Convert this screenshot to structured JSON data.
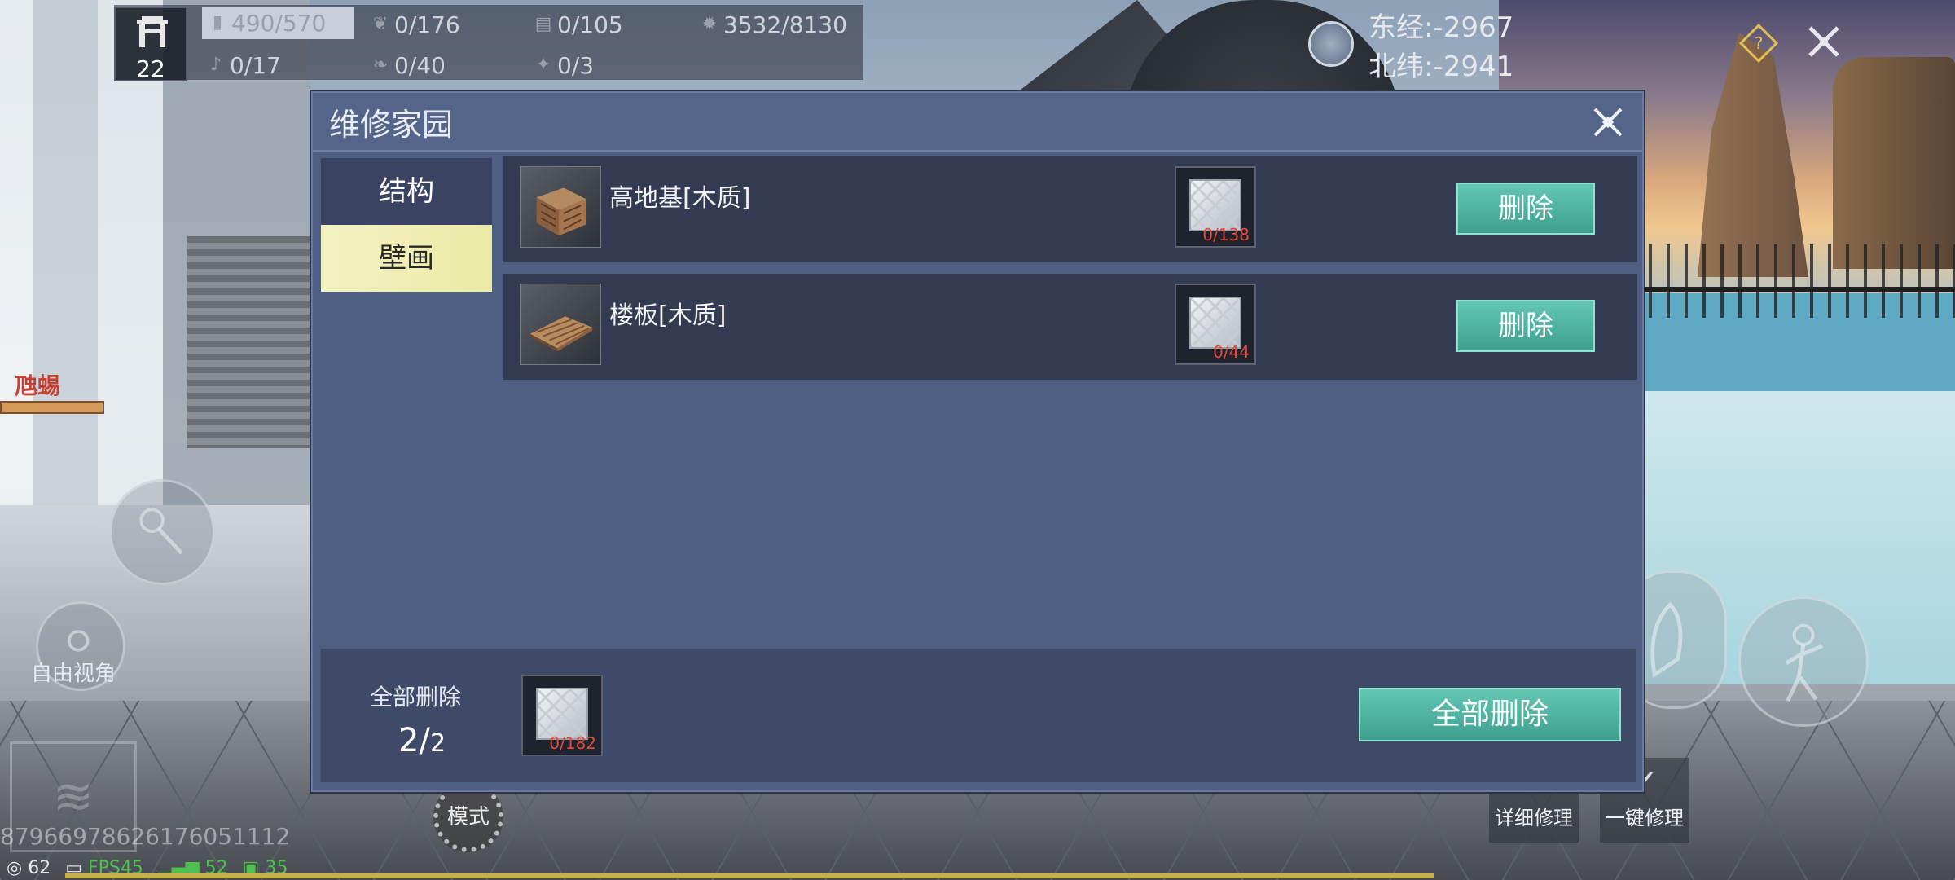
{
  "hud": {
    "level": "22",
    "stats_row1": [
      {
        "icon": "resource-bars-icon",
        "value": "490/570",
        "active": true
      },
      {
        "icon": "leaf-icon",
        "value": "0/176",
        "active": false
      },
      {
        "icon": "cabinet-icon",
        "value": "0/105",
        "active": false
      },
      {
        "icon": "gear-icon",
        "value": "3532/8130",
        "active": false
      }
    ],
    "stats_row2": [
      {
        "icon": "guitar-icon",
        "value": "0/17"
      },
      {
        "icon": "feather-icon",
        "value": "0/40"
      },
      {
        "icon": "bird-icon",
        "value": "0/3"
      }
    ],
    "longitude": "东经:-2967",
    "latitude": "北纬:-2941",
    "help_glyph": "?"
  },
  "left_hud": {
    "npc_name": "虺蜴",
    "free_camera_label": "自由视角",
    "mode_label": "模式",
    "uid": "87966978626176051112",
    "ping": "62",
    "fps": "FPS45",
    "signal": "52",
    "battery": "35"
  },
  "right_hud": {
    "detail_repair": "详细修理",
    "one_click_repair": "一键修理"
  },
  "dialog": {
    "title": "维修家园",
    "tabs": [
      {
        "label": "结构",
        "active": false
      },
      {
        "label": "壁画",
        "active": true
      }
    ],
    "items": [
      {
        "name": "高地基[木质]",
        "thumb": "wooden-crate-icon",
        "cost": "0/138",
        "delete_label": "删除"
      },
      {
        "name": "楼板[木质]",
        "thumb": "wooden-plank-icon",
        "cost": "0/44",
        "delete_label": "删除"
      }
    ],
    "footer": {
      "label": "全部删除",
      "count_current": "2",
      "count_sep": "/",
      "count_total": "2",
      "cost": "0/182",
      "delete_all_label": "全部删除"
    }
  },
  "colors": {
    "dialog_bg": "#4e5e82",
    "row_bg": "#333b52",
    "tab_active": "#eceaa6",
    "button_teal": "#4fb3a1",
    "cost_red": "#e24a3a"
  }
}
